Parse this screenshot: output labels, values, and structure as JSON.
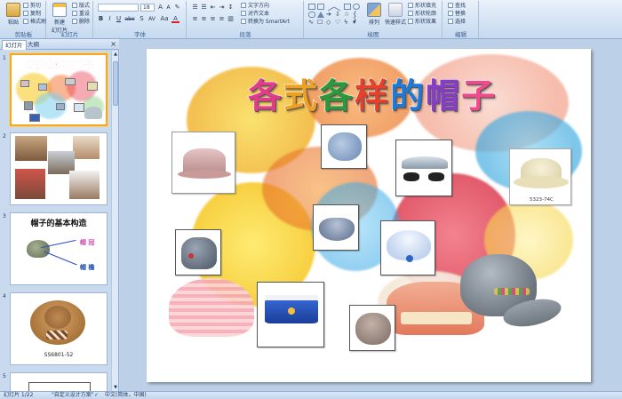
{
  "ribbon": {
    "clipboard": {
      "group": "剪贴板",
      "paste": "粘贴",
      "cut": "剪切",
      "copy": "复制",
      "format_painter": "格式刷"
    },
    "slides": {
      "group": "幻灯片",
      "new_slide": "新建",
      "new_slide_line2": "幻灯片",
      "layout": "版式",
      "reset": "重设",
      "delete": "删除"
    },
    "font": {
      "group": "字体",
      "font_name": "",
      "font_size": "18",
      "bold": "B",
      "italic": "I",
      "underline": "U",
      "strike": "abe",
      "shadow": "S",
      "spacing": "AV",
      "case": "Aa",
      "color": "A"
    },
    "paragraph": {
      "group": "段落",
      "text_direction": "文字方向",
      "align_text": "对齐文本",
      "smartart": "转换为 SmartArt"
    },
    "drawing": {
      "group": "绘图",
      "arrange": "排列",
      "quick_styles": "快速样式",
      "shape_fill": "形状填充",
      "shape_outline": "形状轮廓",
      "shape_effects": "形状效果"
    },
    "editing": {
      "group": "编辑",
      "find": "查找",
      "replace": "替换",
      "select": "选择"
    }
  },
  "panel": {
    "tab_slides": "幻灯片",
    "tab_outline": "大纲",
    "close": "×",
    "thumbs": [
      {
        "num": "1",
        "title": "各式各样的帽子"
      },
      {
        "num": "2"
      },
      {
        "num": "3",
        "title": "帽子的基本构造",
        "label_a": "帽 冠",
        "label_b": "帽 檐"
      },
      {
        "num": "4",
        "caption": "SS6801-52"
      },
      {
        "num": "5"
      }
    ]
  },
  "slide": {
    "title_chars": [
      "各",
      "式",
      "各",
      "样",
      "的",
      "帽",
      "子"
    ],
    "title_colors": [
      "#e23b8a",
      "#f0a020",
      "#2a9a3a",
      "#e8402a",
      "#1d7ad8",
      "#8a3cc8",
      "#f04a8a"
    ],
    "hat_caption": "5323-74C"
  },
  "status": {
    "slide_info": "幻灯片 1/22",
    "theme": "\"自定义设计方案\"",
    "language": "中文(简体，中国)"
  }
}
